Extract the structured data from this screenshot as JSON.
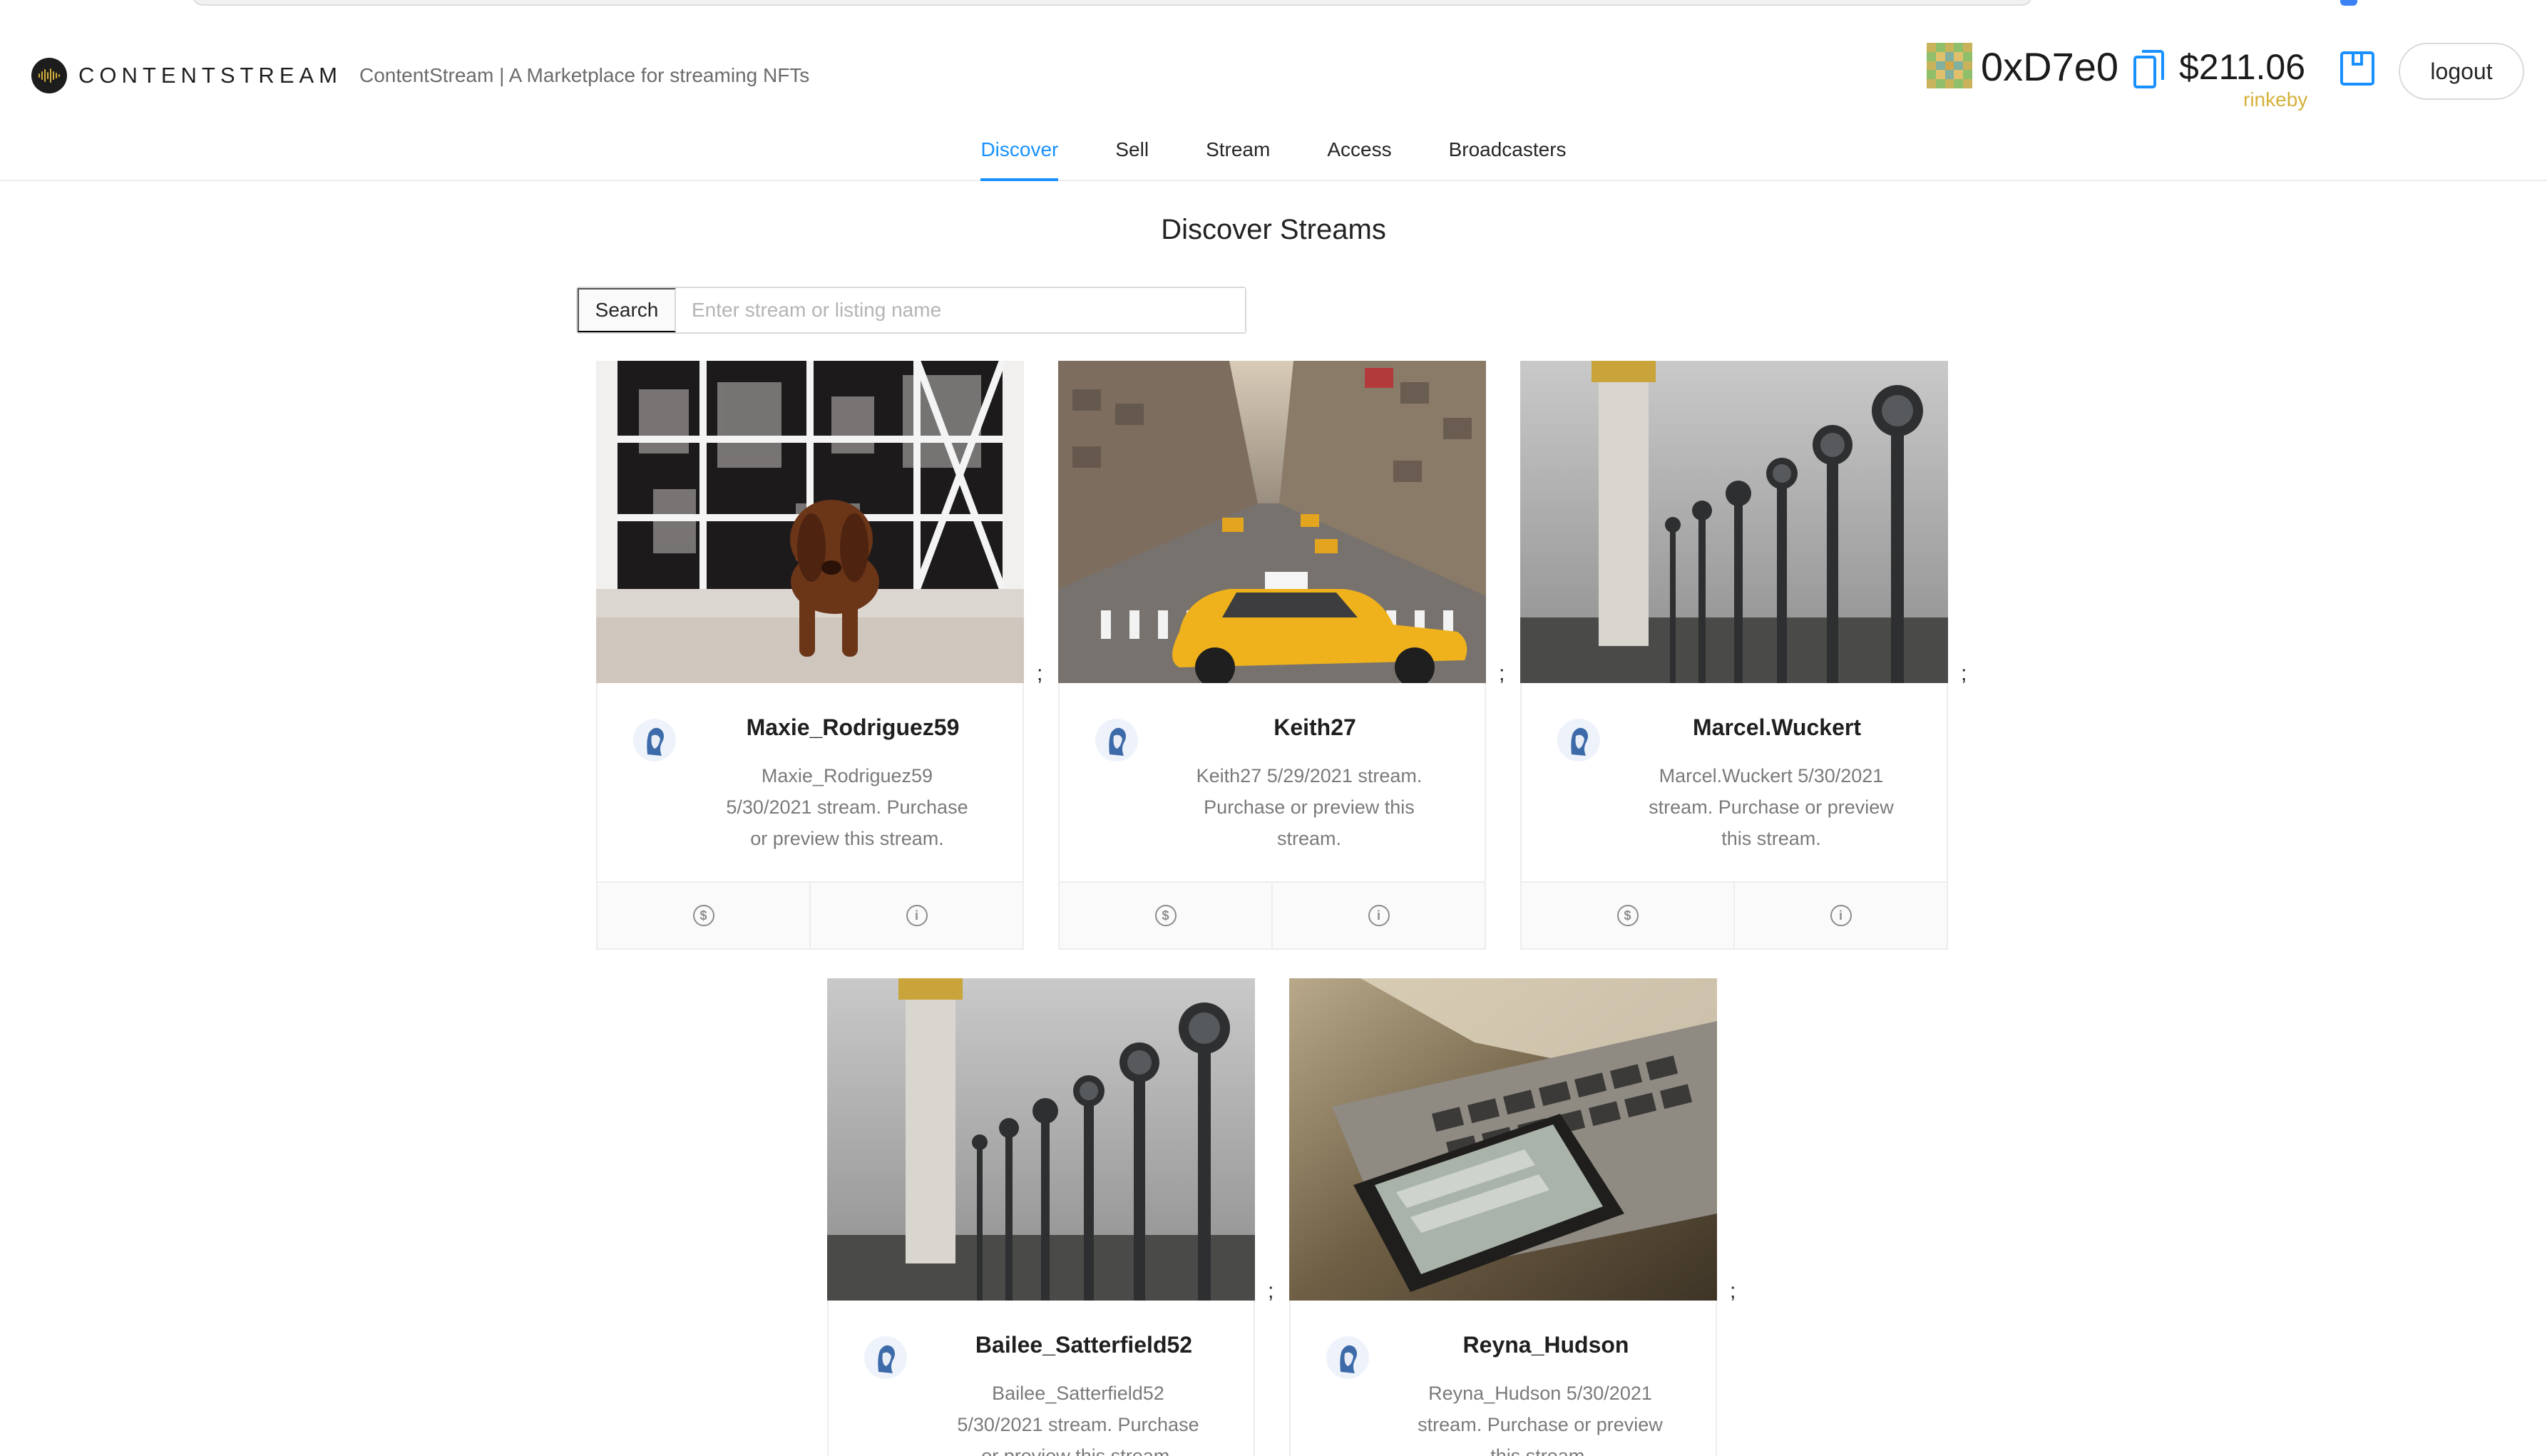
{
  "brand": {
    "name": "CONTENTSTREAM",
    "tagline": "ContentStream | A Marketplace for streaming NFTs"
  },
  "wallet": {
    "address": "0xD7e0",
    "balance": "$211.06",
    "network": "rinkeby",
    "identicon_icon": "identicon",
    "copy_icon": "copy-icon",
    "wallet_icon": "wallet-icon"
  },
  "header": {
    "logout_label": "logout"
  },
  "nav": {
    "items": [
      {
        "label": "Discover",
        "active": true
      },
      {
        "label": "Sell",
        "active": false
      },
      {
        "label": "Stream",
        "active": false
      },
      {
        "label": "Access",
        "active": false
      },
      {
        "label": "Broadcasters",
        "active": false
      }
    ]
  },
  "main": {
    "title": "Discover Streams",
    "search_label": "Search",
    "search_placeholder": "Enter stream or listing name",
    "separator": ";"
  },
  "cards": [
    {
      "title": "Maxie_Rodriguez59",
      "desc_lines": [
        "Maxie_Rodriguez59",
        "5/30/2021 stream. Purchase",
        "or preview this stream."
      ],
      "image": "dog-window-photo"
    },
    {
      "title": "Keith27",
      "desc_lines": [
        "Keith27 5/29/2021 stream.",
        "Purchase or preview this",
        "stream."
      ],
      "image": "city-taxi-photo"
    },
    {
      "title": "Marcel.Wuckert",
      "desc_lines": [
        "Marcel.Wuckert 5/30/2021",
        "stream. Purchase or preview",
        "this stream."
      ],
      "image": "bridge-lamps-photo"
    },
    {
      "title": "Bailee_Satterfield52",
      "desc_lines": [
        "Bailee_Satterfield52",
        "5/30/2021 stream. Purchase",
        "or preview this stream."
      ],
      "image": "bridge-lamps-photo"
    },
    {
      "title": "Reyna_Hudson",
      "desc_lines": [
        "Reyna_Hudson 5/30/2021",
        "stream. Purchase or preview",
        "this stream."
      ],
      "image": "phone-laptop-photo"
    }
  ],
  "colors": {
    "accent": "#1890ff",
    "network": "#d4b13a",
    "border": "#ededed"
  }
}
